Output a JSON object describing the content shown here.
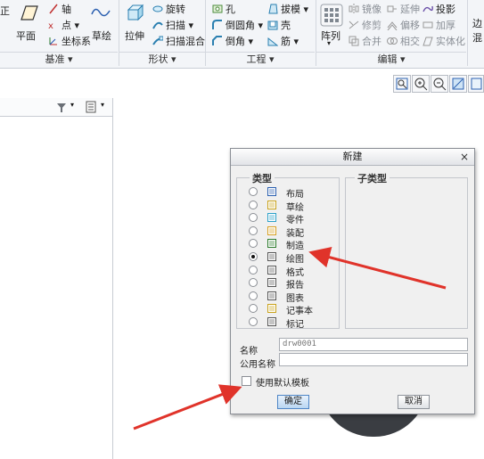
{
  "ribbon": {
    "items": {
      "zheng": "正",
      "plane": "平面",
      "axis": "轴",
      "point": "点",
      "coord": "坐标系",
      "sketch": "草绘",
      "extrude": "拉伸",
      "revolve": "旋转",
      "sweep": "扫描",
      "swept_blend": "扫描混合",
      "hole": "孔",
      "round": "倒圆角",
      "chamfer": "倒角",
      "draft": "拔模",
      "shell": "壳",
      "rib": "筋",
      "pattern": "阵列",
      "mirror": "镜像",
      "merge": "合并",
      "trim": "修剪",
      "offset": "偏移",
      "intersect": "相交",
      "extend": "延伸",
      "project": "投影",
      "thicken": "加厚",
      "solidify": "实体化",
      "edge1": "边",
      "edge2": "混"
    },
    "groups": {
      "datum": "基准",
      "shapes": "形状",
      "engineering": "工程",
      "editing": "编辑"
    }
  },
  "dialog": {
    "title": "新建",
    "close": "×",
    "type_legend": "类型",
    "subtype_legend": "子类型",
    "types": [
      {
        "label": "布局",
        "icon": "layout-icon",
        "selected": false
      },
      {
        "label": "草绘",
        "icon": "sketch-icon",
        "selected": false
      },
      {
        "label": "零件",
        "icon": "part-icon",
        "selected": false
      },
      {
        "label": "装配",
        "icon": "assembly-icon",
        "selected": false
      },
      {
        "label": "制造",
        "icon": "manufacturing-icon",
        "selected": false
      },
      {
        "label": "绘图",
        "icon": "drawing-icon",
        "selected": true
      },
      {
        "label": "格式",
        "icon": "format-icon",
        "selected": false
      },
      {
        "label": "报告",
        "icon": "report-icon",
        "selected": false
      },
      {
        "label": "图表",
        "icon": "diagram-icon",
        "selected": false
      },
      {
        "label": "记事本",
        "icon": "notebook-icon",
        "selected": false
      },
      {
        "label": "标记",
        "icon": "markup-icon",
        "selected": false
      }
    ],
    "name_label": "名称",
    "name_value": "drw0001",
    "common_name_label": "公用名称",
    "common_name_value": "",
    "use_default_template": "使用默认模板",
    "ok": "确定",
    "cancel": "取消"
  },
  "colors": {
    "annotation_arrow": "#e0332a",
    "ok_button": "#b9d6f2"
  }
}
